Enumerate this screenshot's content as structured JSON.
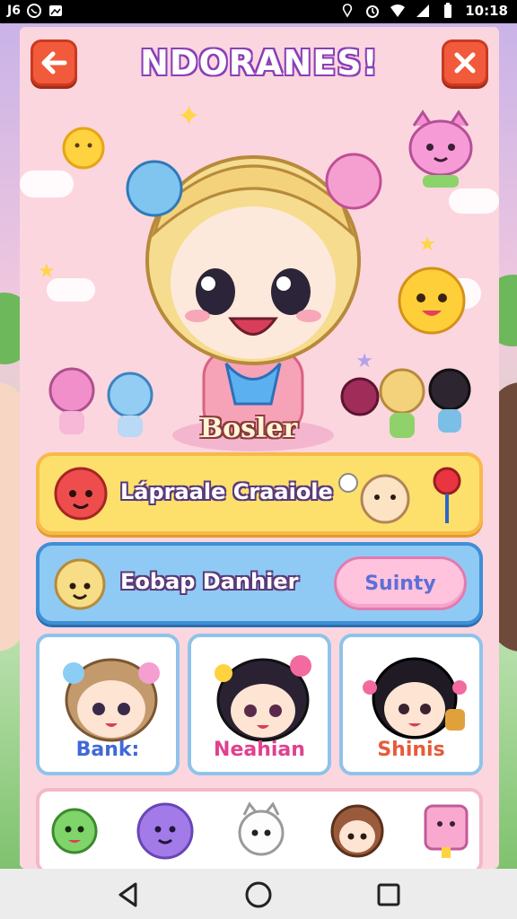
{
  "status_bar": {
    "left_icons": [
      "signal-app-icon",
      "whatsapp-icon",
      "gallery-icon"
    ],
    "left_text": "J6",
    "time": "10:18",
    "right_icons": [
      "location-icon",
      "alarm-icon",
      "wifi-icon",
      "cell-signal-icon",
      "battery-icon"
    ]
  },
  "header": {
    "title": "NDORANES!",
    "back_icon": "back-arrow-icon",
    "close_icon": "close-x-icon"
  },
  "hero": {
    "character_name": "Bosler"
  },
  "cards": [
    {
      "label": "Lápraale Craaiole",
      "icon": "red-cat-avatar-icon"
    },
    {
      "label": "Eobap Danhier",
      "button_label": "Suinty",
      "icon": "blonde-avatar-icon"
    }
  ],
  "characters": [
    {
      "name": "Bank:",
      "name_color": "#3f68d8"
    },
    {
      "name": "Neahian",
      "name_color": "#e0408f"
    },
    {
      "name": "Shinis",
      "name_color": "#e75b39"
    }
  ],
  "bottom_icons": [
    "green-monster-icon",
    "purple-monster-icon",
    "white-cat-icon",
    "brown-bear-girl-icon",
    "pink-card-icon"
  ],
  "nav": {
    "back": "nav-back-icon",
    "home": "nav-home-icon",
    "recents": "nav-recents-icon"
  },
  "colors": {
    "panel_bg": "#fbd6df",
    "accent_red": "#f25a3c",
    "card_yellow": "#fde06b",
    "card_blue": "#8fcaf4",
    "pill_pink": "#ffc3dd"
  }
}
